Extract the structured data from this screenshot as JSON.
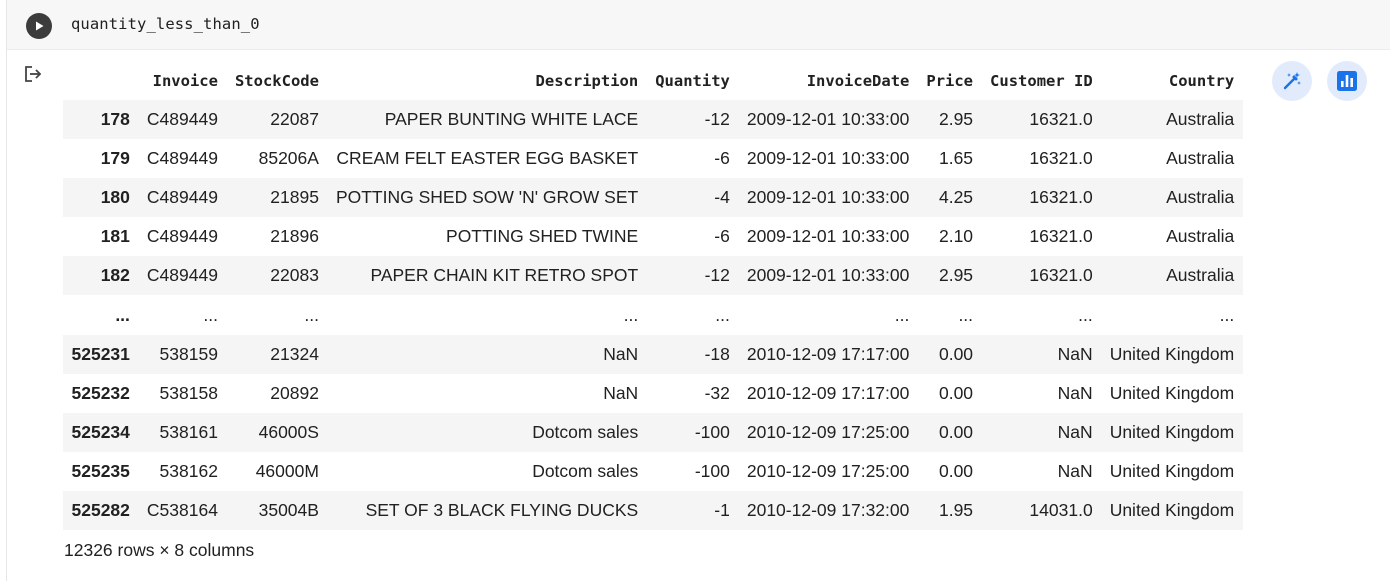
{
  "code_cell": {
    "code": "quantity_less_than_0",
    "run_icon": "play-icon"
  },
  "output": {
    "output_icon": "output-redirect-icon",
    "columns": [
      "Invoice",
      "StockCode",
      "Description",
      "Quantity",
      "InvoiceDate",
      "Price",
      "Customer ID",
      "Country"
    ],
    "rows": [
      {
        "index": "178",
        "cells": [
          "C489449",
          "22087",
          "PAPER BUNTING WHITE LACE",
          "-12",
          "2009-12-01 10:33:00",
          "2.95",
          "16321.0",
          "Australia"
        ]
      },
      {
        "index": "179",
        "cells": [
          "C489449",
          "85206A",
          "CREAM FELT EASTER EGG BASKET",
          "-6",
          "2009-12-01 10:33:00",
          "1.65",
          "16321.0",
          "Australia"
        ]
      },
      {
        "index": "180",
        "cells": [
          "C489449",
          "21895",
          "POTTING SHED SOW 'N' GROW SET",
          "-4",
          "2009-12-01 10:33:00",
          "4.25",
          "16321.0",
          "Australia"
        ]
      },
      {
        "index": "181",
        "cells": [
          "C489449",
          "21896",
          "POTTING SHED TWINE",
          "-6",
          "2009-12-01 10:33:00",
          "2.10",
          "16321.0",
          "Australia"
        ]
      },
      {
        "index": "182",
        "cells": [
          "C489449",
          "22083",
          "PAPER CHAIN KIT RETRO SPOT",
          "-12",
          "2009-12-01 10:33:00",
          "2.95",
          "16321.0",
          "Australia"
        ]
      },
      {
        "index": "...",
        "cells": [
          "...",
          "...",
          "...",
          "...",
          "...",
          "...",
          "...",
          "..."
        ]
      },
      {
        "index": "525231",
        "cells": [
          "538159",
          "21324",
          "NaN",
          "-18",
          "2010-12-09 17:17:00",
          "0.00",
          "NaN",
          "United Kingdom"
        ]
      },
      {
        "index": "525232",
        "cells": [
          "538158",
          "20892",
          "NaN",
          "-32",
          "2010-12-09 17:17:00",
          "0.00",
          "NaN",
          "United Kingdom"
        ]
      },
      {
        "index": "525234",
        "cells": [
          "538161",
          "46000S",
          "Dotcom sales",
          "-100",
          "2010-12-09 17:25:00",
          "0.00",
          "NaN",
          "United Kingdom"
        ]
      },
      {
        "index": "525235",
        "cells": [
          "538162",
          "46000M",
          "Dotcom sales",
          "-100",
          "2010-12-09 17:25:00",
          "0.00",
          "NaN",
          "United Kingdom"
        ]
      },
      {
        "index": "525282",
        "cells": [
          "C538164",
          "35004B",
          "SET OF 3 BLACK FLYING DUCKS",
          "-1",
          "2010-12-09 17:32:00",
          "1.95",
          "14031.0",
          "United Kingdom"
        ]
      }
    ],
    "shape_text": "12326 rows × 8 columns",
    "side_buttons": [
      {
        "name": "magic-wand-icon"
      },
      {
        "name": "bar-chart-icon"
      }
    ],
    "colors": {
      "accent": "#1a73e8",
      "button_bg": "#e1ebfb",
      "row_shade": "#f5f5f5",
      "code_bg": "#f7f7f7"
    }
  }
}
